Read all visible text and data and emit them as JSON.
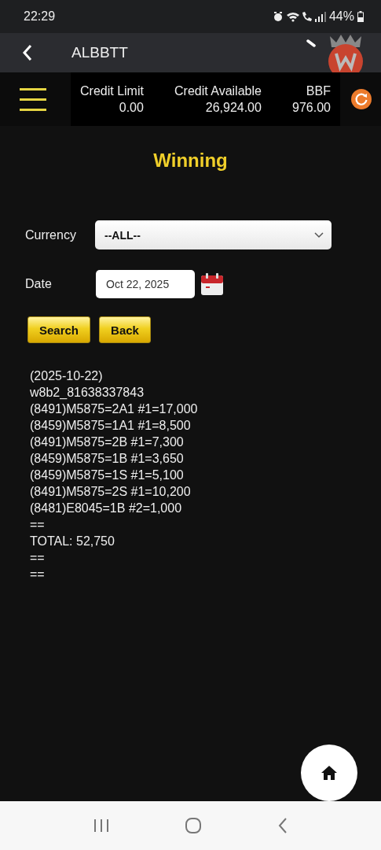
{
  "status_bar": {
    "time": "22:29",
    "battery": "44%"
  },
  "app_bar": {
    "title": "ALBBTT"
  },
  "credit": [
    {
      "label": "Credit Limit",
      "value": "0.00"
    },
    {
      "label": "Credit Available",
      "value": "26,924.00"
    },
    {
      "label": "BBF",
      "value": "976.00"
    }
  ],
  "page_title": "Winning",
  "form": {
    "currency": {
      "label": "Currency",
      "value": "--ALL--"
    },
    "date": {
      "label": "Date",
      "value": "Oct 22, 2025"
    }
  },
  "buttons": [
    "Search",
    "Back"
  ],
  "report": [
    "(2025-10-22)",
    "w8b2_81638337843",
    "(8491)M5875=2A1 #1=17,000",
    "(8459)M5875=1A1 #1=8,500",
    "(8491)M5875=2B #1=7,300",
    "(8459)M5875=1B #1=3,650",
    "(8459)M5875=1S #1=5,100",
    "(8491)M5875=2S #1=10,200",
    "(8481)E8045=1B #2=1,000",
    "==",
    "TOTAL: 52,750",
    "==",
    "=="
  ]
}
